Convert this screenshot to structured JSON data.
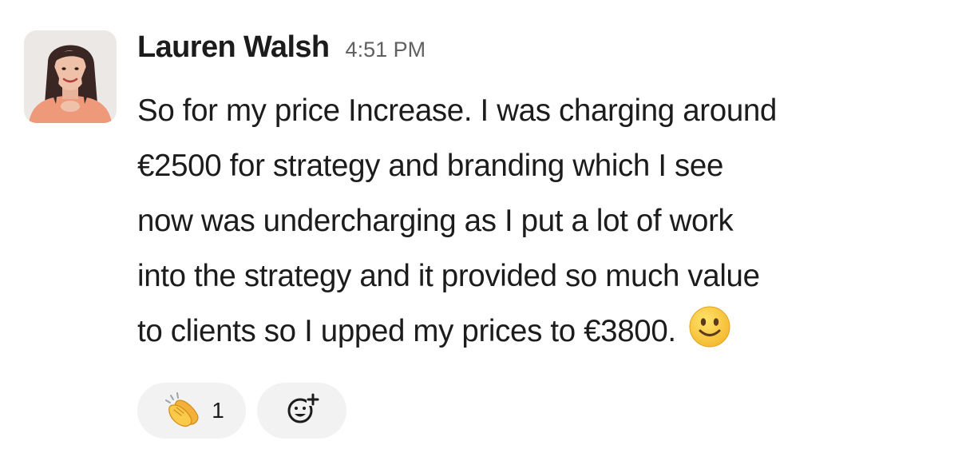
{
  "message": {
    "sender": "Lauren Walsh",
    "timestamp": "4:51 PM",
    "body_lines": [
      "So for my price Increase. I was charging around",
      "€2500 for strategy and branding which I see",
      "now was undercharging as I put a lot of work",
      "into the strategy and it provided so much value",
      "to clients so I upped my prices to €3800."
    ],
    "trailing_emoji": "slightly-smiling-face-icon"
  },
  "reactions": [
    {
      "emoji": "clapping-hands-icon",
      "count": "1"
    }
  ],
  "add_reaction_icon": "add-reaction-icon",
  "colors": {
    "text": "#1d1c1d",
    "timestamp": "#616061",
    "reaction_bg": "#f2f2f2"
  }
}
